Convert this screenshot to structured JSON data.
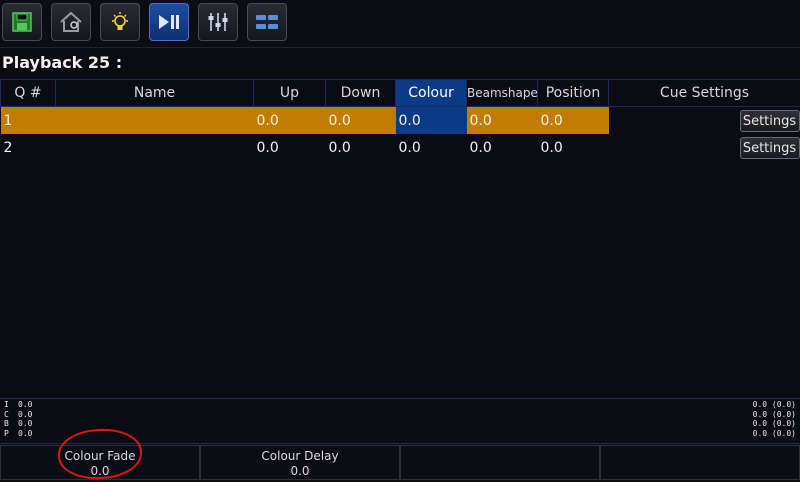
{
  "toolbar": {
    "buttons": [
      {
        "icon": "save-icon"
      },
      {
        "icon": "home-icon"
      },
      {
        "icon": "lightbulb-icon"
      },
      {
        "icon": "play-pause-icon",
        "active": true
      },
      {
        "icon": "faders-icon"
      },
      {
        "icon": "grid-icon"
      }
    ]
  },
  "playback": {
    "title": "Playback 25 :"
  },
  "table": {
    "headers": [
      "Q #",
      "Name",
      "Up",
      "Down",
      "Colour",
      "Beamshape",
      "Position",
      "Cue Settings"
    ],
    "highlighted_column": "Colour",
    "rows": [
      {
        "q": "1",
        "name": "",
        "up": "0.0",
        "down": "0.0",
        "colour": "0.0",
        "beamshape": "0.0",
        "position": "0.0",
        "settings": "Settings",
        "selected": true
      },
      {
        "q": "2",
        "name": "",
        "up": "0.0",
        "down": "0.0",
        "colour": "0.0",
        "beamshape": "0.0",
        "position": "0.0",
        "settings": "Settings",
        "selected": false
      }
    ]
  },
  "readout": {
    "left": [
      {
        "k": "I",
        "v": "0.0"
      },
      {
        "k": "C",
        "v": "0.0"
      },
      {
        "k": "B",
        "v": "0.0"
      },
      {
        "k": "P",
        "v": "0.0"
      }
    ],
    "right": [
      "0.0 (0.0)",
      "0.0 (0.0)",
      "0.0 (0.0)",
      "0.0 (0.0)"
    ]
  },
  "softkeys": [
    {
      "label": "Colour Fade",
      "value": "0.0"
    },
    {
      "label": "Colour Delay",
      "value": "0.0"
    },
    {
      "label": "",
      "value": ""
    },
    {
      "label": "",
      "value": ""
    }
  ],
  "colors": {
    "selected_row": "#c27c00",
    "highlight": "#0d3a86",
    "annotation": "#d81818"
  }
}
